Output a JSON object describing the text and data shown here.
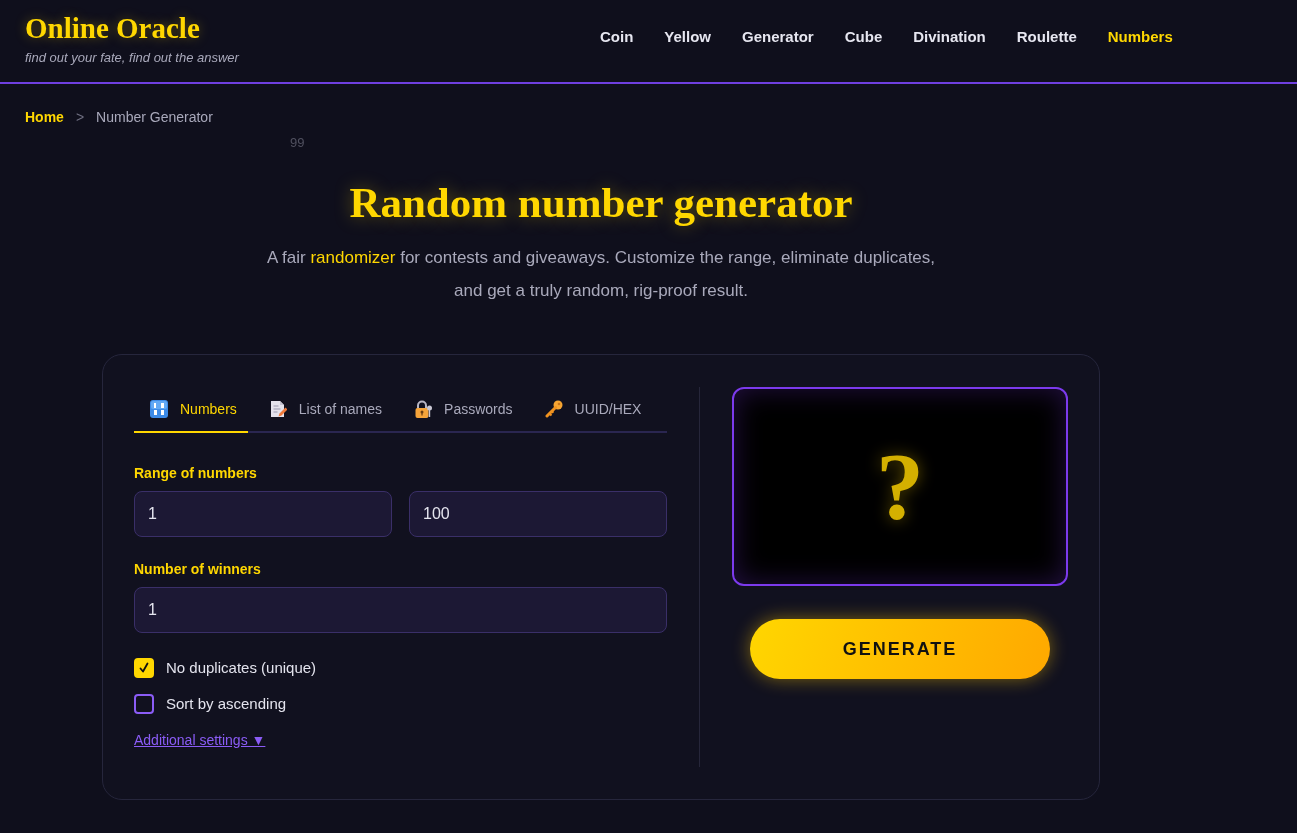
{
  "header": {
    "logo": "Online Oracle",
    "tagline": "find out your fate, find out the answer",
    "nav": [
      {
        "label": "Coin",
        "selected": false
      },
      {
        "label": "Yellow",
        "selected": false
      },
      {
        "label": "Generator",
        "selected": false
      },
      {
        "label": "Cube",
        "selected": false
      },
      {
        "label": "Divination",
        "selected": false
      },
      {
        "label": "Roulette",
        "selected": false
      },
      {
        "label": "Numbers",
        "selected": true
      }
    ]
  },
  "breadcrumb": {
    "items": [
      {
        "label": "Home",
        "kind": "link"
      },
      {
        "label": "Number Generator",
        "kind": "current"
      }
    ],
    "separator": ">"
  },
  "decoration": {
    "floating_number": "99"
  },
  "hero": {
    "title": "Random number generator",
    "subtitle": [
      {
        "text": "A fair ",
        "highlight": false
      },
      {
        "text": "randomizer",
        "highlight": true
      },
      {
        "text": " for contests and giveaways. Customize the range, eliminate duplicates, and get a truly random, rig-proof result.",
        "highlight": false
      }
    ]
  },
  "generator": {
    "tabs": [
      {
        "label": "Numbers",
        "kind": "numbers",
        "selected": true
      },
      {
        "label": "List of names",
        "kind": "names",
        "selected": false
      },
      {
        "label": "Passwords",
        "kind": "passwords",
        "selected": false
      },
      {
        "label": "UUID/HEX",
        "kind": "uuid",
        "selected": false
      }
    ],
    "range": {
      "label": "Range of numbers",
      "from": "1",
      "to": "100"
    },
    "winners": {
      "label": "Number of winners",
      "value": "1"
    },
    "options": [
      {
        "label": "No duplicates (unique)",
        "checked": true
      },
      {
        "label": "Sort by ascending",
        "checked": false
      }
    ],
    "more_link": "Additional settings ▼",
    "result": {
      "symbol": "?"
    },
    "generate_button": "GENERATE"
  }
}
